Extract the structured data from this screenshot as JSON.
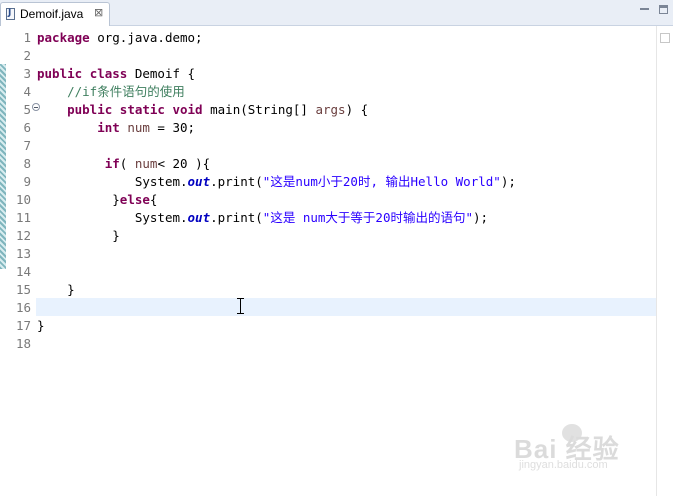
{
  "tab": {
    "title": "Demoif.java",
    "close": "⊠",
    "icon": "java-file-icon"
  },
  "window_controls": {
    "minimize": "minimize-icon",
    "maximize": "maximize-icon"
  },
  "line_numbers": [
    "1",
    "2",
    "3",
    "4",
    "5",
    "6",
    "7",
    "8",
    "9",
    "10",
    "11",
    "12",
    "13",
    "14",
    "15",
    "16",
    "17",
    "18"
  ],
  "code": {
    "l1_kw": "package",
    "l1_rest": " org.java.demo;",
    "l3_kw1": "public",
    "l3_sp1": " ",
    "l3_kw2": "class",
    "l3_rest": " Demoif {",
    "l4_indent": "    ",
    "l4_comment": "//if条件语句的使用",
    "l5_indent": "    ",
    "l5_kw1": "public",
    "l5_sp1": " ",
    "l5_kw2": "static",
    "l5_sp2": " ",
    "l5_kw3": "void",
    "l5_rest1": " main(String[] ",
    "l5_var": "args",
    "l5_rest2": ") {",
    "l6_indent": "        ",
    "l6_kw": "int",
    "l6_sp": " ",
    "l6_var": "num",
    "l6_rest": " = 30;",
    "l8_indent": "         ",
    "l8_kw": "if",
    "l8_rest1": "( ",
    "l8_var": "num",
    "l8_rest2": "< 20 ){",
    "l9_indent": "             ",
    "l9_pre": "System.",
    "l9_field": "out",
    "l9_mid": ".print(",
    "l9_str": "\"这是num小于20时, 输出Hello World\"",
    "l9_post": ");",
    "l10_indent": "          ",
    "l10_brace": "}",
    "l10_kw": "else",
    "l10_rest": "{",
    "l11_indent": "             ",
    "l11_pre": "System.",
    "l11_field": "out",
    "l11_mid": ".print(",
    "l11_str": "\"这是 num大于等于20时输出的语句\"",
    "l11_post": ");",
    "l12_text": "          }",
    "l15_text": "    }",
    "l17_text": "}"
  },
  "watermark": {
    "main": "Bai 经验",
    "sub": "jingyan.baidu.com"
  },
  "colors": {
    "keyword": "#7f0055",
    "comment": "#3f7f5f",
    "string": "#2a00ff",
    "field": "#0000c0",
    "current_line": "#e8f2fe"
  }
}
